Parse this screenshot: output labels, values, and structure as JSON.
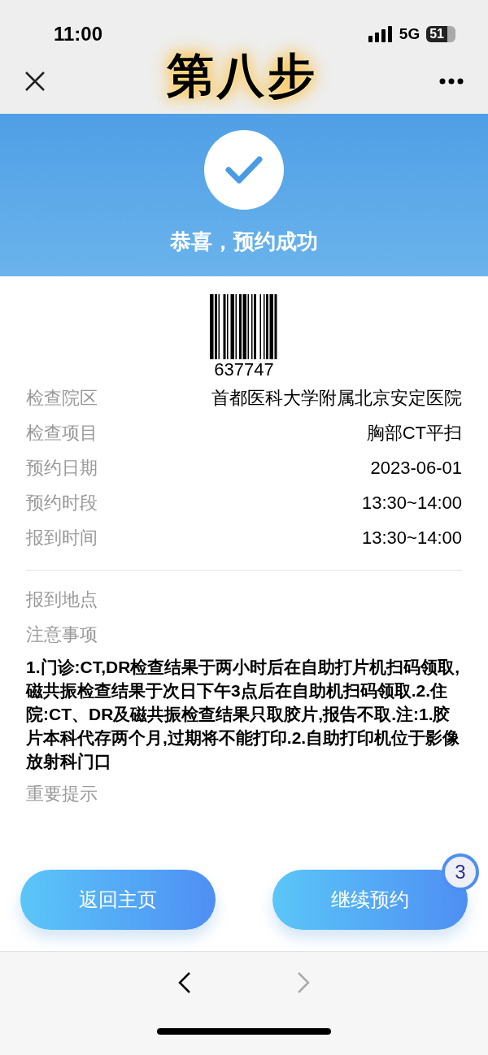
{
  "status_bar": {
    "time": "11:00",
    "network": "5G",
    "battery": "51"
  },
  "nav": {
    "step_label": "第八步"
  },
  "banner": {
    "message": "恭喜，预约成功"
  },
  "barcode": {
    "number": "637747"
  },
  "details": [
    {
      "label": "检查院区",
      "value": "首都医科大学附属北京安定医院"
    },
    {
      "label": "检查项目",
      "value": "胸部CT平扫"
    },
    {
      "label": "预约日期",
      "value": "2023-06-01"
    },
    {
      "label": "预约时段",
      "value": "13:30~14:00"
    },
    {
      "label": "报到时间",
      "value": "13:30~14:00"
    }
  ],
  "sections": [
    {
      "kind": "label",
      "text": "报到地点"
    },
    {
      "kind": "label",
      "text": "注意事项"
    },
    {
      "kind": "body",
      "text": "1.门诊:CT,DR检查结果于两小时后在自助打片机扫码领取,磁共振检查结果于次日下午3点后在自助机扫码领取.2.住院:CT、DR及磁共振检查结果只取胶片,报告不取.注:1.胶片本科代存两个月,过期将不能打印.2.自助打印机位于影像放射科门口"
    },
    {
      "kind": "label",
      "text": "重要提示"
    }
  ],
  "buttons": [
    {
      "label": "返回主页"
    },
    {
      "label": "继续预约",
      "badge": "3"
    }
  ],
  "browser_nav": {
    "back_disabled": false,
    "forward_disabled": true
  }
}
